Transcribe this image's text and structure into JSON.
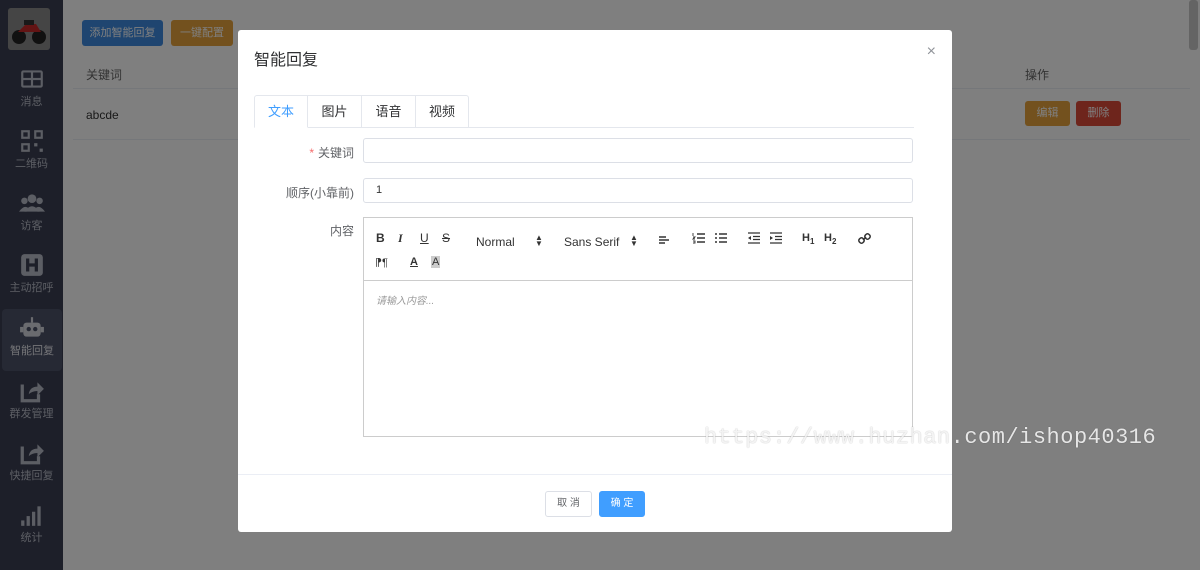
{
  "sidebar": {
    "items": [
      {
        "label": "消息",
        "icon": "grid-icon"
      },
      {
        "label": "二维码",
        "icon": "qrcode-icon"
      },
      {
        "label": "访客",
        "icon": "users-icon"
      },
      {
        "label": "主动招呼",
        "icon": "h-square-icon"
      },
      {
        "label": "智能回复",
        "icon": "robot-icon"
      },
      {
        "label": "群发管理",
        "icon": "share-icon"
      },
      {
        "label": "快捷回复",
        "icon": "share-icon"
      },
      {
        "label": "统计",
        "icon": "signal-icon"
      }
    ],
    "active_index": 4
  },
  "background": {
    "add_button": "添加智能回复",
    "config_button": "一键配置",
    "table": {
      "headers": [
        "关键词",
        "操作"
      ],
      "rows": [
        {
          "keyword": "abcde",
          "edit": "编辑",
          "delete": "删除"
        }
      ]
    }
  },
  "dialog": {
    "title": "智能回复",
    "close": "×",
    "tabs": [
      "文本",
      "图片",
      "语音",
      "视频"
    ],
    "active_tab": 0,
    "fields": {
      "keyword_label": "关键词",
      "keyword_value": "",
      "order_label": "顺序(小靠前)",
      "order_value": "1",
      "content_label": "内容"
    },
    "editor": {
      "size_picker": "Normal",
      "font_picker": "Sans Serif",
      "placeholder": "请输入内容..."
    },
    "cancel": "取 消",
    "confirm": "确 定"
  },
  "watermark": "https://www.huzhan.com/ishop40316",
  "colors": {
    "primary": "#409eff",
    "add_button": "#3e8be0",
    "config_button": "#e6a23c",
    "edit_button": "#e6a23c",
    "delete_button": "#dd4b39",
    "sidebar": "#3a3f52"
  }
}
